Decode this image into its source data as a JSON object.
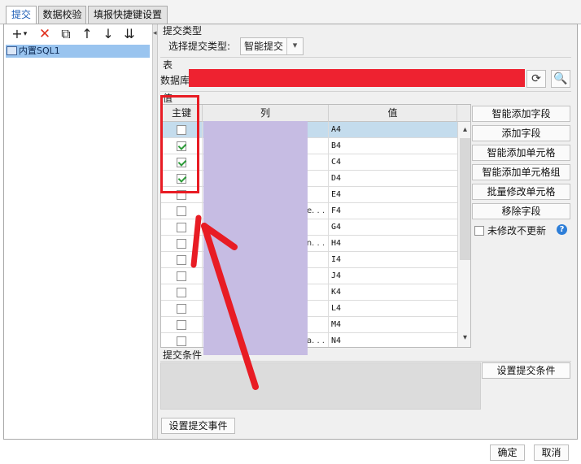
{
  "tabs": [
    {
      "label": "提交",
      "active": true
    },
    {
      "label": "数据校验",
      "active": false
    },
    {
      "label": "填报快捷键设置",
      "active": false
    }
  ],
  "toolbar": {
    "add": "+",
    "add_dropdown": "▾",
    "delete": "✕",
    "copy": "⧉",
    "up": "↑",
    "down": "↓",
    "move_bottom": "⇊"
  },
  "tree": {
    "items": [
      {
        "label": "内置SQL1",
        "selected": true
      }
    ]
  },
  "submit_type": {
    "section": "提交类型",
    "label": "选择提交类型:",
    "value": "智能提交",
    "arrow": "▾"
  },
  "table_section": {
    "section": "表",
    "db_label": "数据库",
    "refresh_icon": "⟳",
    "browse_icon": "🔍"
  },
  "values_section": {
    "section": "值",
    "headers": [
      "主键",
      "列",
      "值"
    ],
    "rows": [
      {
        "key": false,
        "col": "",
        "val": "A4",
        "selected": true
      },
      {
        "key": true,
        "col": "",
        "val": "B4"
      },
      {
        "key": true,
        "col": "",
        "val": "C4"
      },
      {
        "key": true,
        "col": "",
        "val": "D4"
      },
      {
        "key": false,
        "col": "",
        "val": "E4"
      },
      {
        "key": false,
        "col": "e. . .",
        "val": "F4"
      },
      {
        "key": false,
        "col": "",
        "val": "G4"
      },
      {
        "key": false,
        "col": "n. . .",
        "val": "H4"
      },
      {
        "key": false,
        "col": "",
        "val": "I4"
      },
      {
        "key": false,
        "col": "",
        "val": "J4"
      },
      {
        "key": false,
        "col": "",
        "val": "K4"
      },
      {
        "key": false,
        "col": "",
        "val": "L4"
      },
      {
        "key": false,
        "col": "",
        "val": "M4"
      },
      {
        "key": false,
        "col": "a. . .",
        "val": "N4"
      }
    ],
    "scroll_up": "▴",
    "scroll_down": "▾"
  },
  "side_buttons": [
    "智能添加字段",
    "添加字段",
    "智能添加单元格",
    "智能添加单元格组",
    "批量修改单元格",
    "移除字段"
  ],
  "no_change_checkbox": {
    "label": "未修改不更新",
    "checked": false
  },
  "help_icon": "?",
  "conditions": {
    "section": "提交条件",
    "set_button": "设置提交条件"
  },
  "event_button": "设置提交事件",
  "dialog": {
    "ok": "确定",
    "cancel": "取消"
  },
  "colors": {
    "redaction_red": "#ee2230",
    "redaction_purple": "#c6bce3",
    "annotation_red": "#e81c24",
    "selection_blue": "#c4dced"
  }
}
